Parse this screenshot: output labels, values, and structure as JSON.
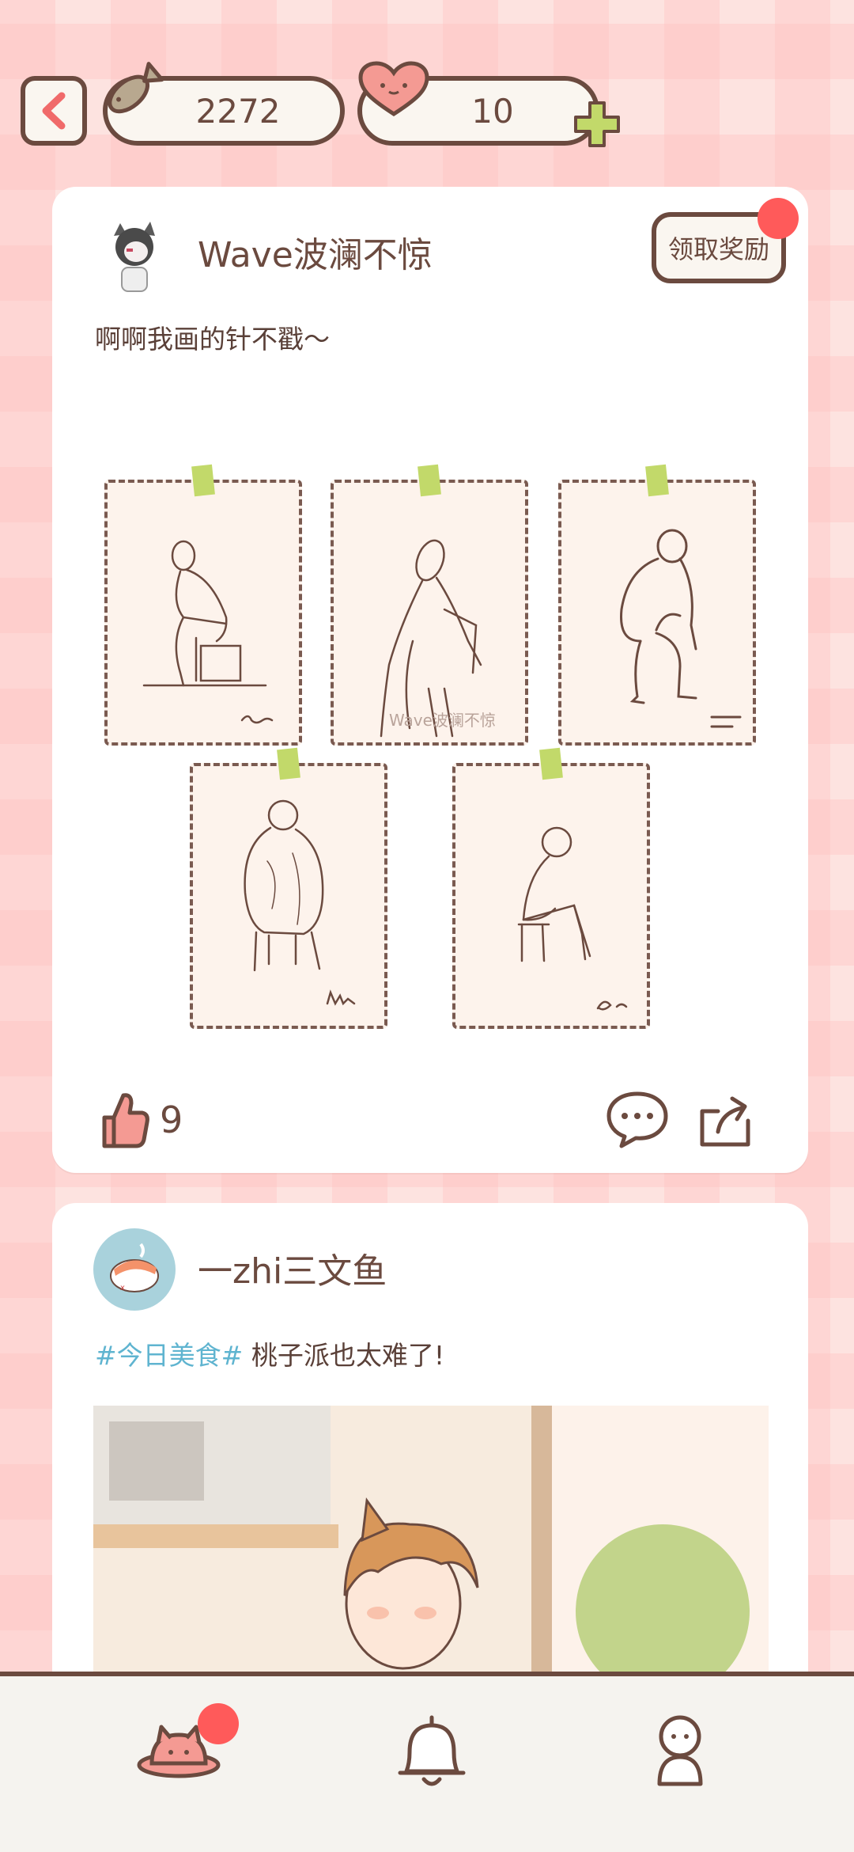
{
  "header": {
    "fish_count": "2272",
    "heart_count": "10"
  },
  "posts": [
    {
      "username": "Wave波澜不惊",
      "reward_label": "领取奖励",
      "text": "啊啊我画的针不戳～",
      "watermark": "Wave波澜不惊",
      "likes": "9",
      "icons": [
        "like-icon",
        "comment-icon",
        "share-icon"
      ]
    },
    {
      "username": "一zhi三文鱼",
      "hashtag": "#今日美食#",
      "text": "桃子派也太难了!"
    }
  ],
  "nav": {
    "items": [
      "home-planet-icon",
      "bell-icon",
      "profile-icon"
    ]
  },
  "colors": {
    "accent_red": "#ff5a5a",
    "outline": "#6b4a3f",
    "hashtag": "#5fb4d0",
    "tape_green": "#c2d96a"
  }
}
